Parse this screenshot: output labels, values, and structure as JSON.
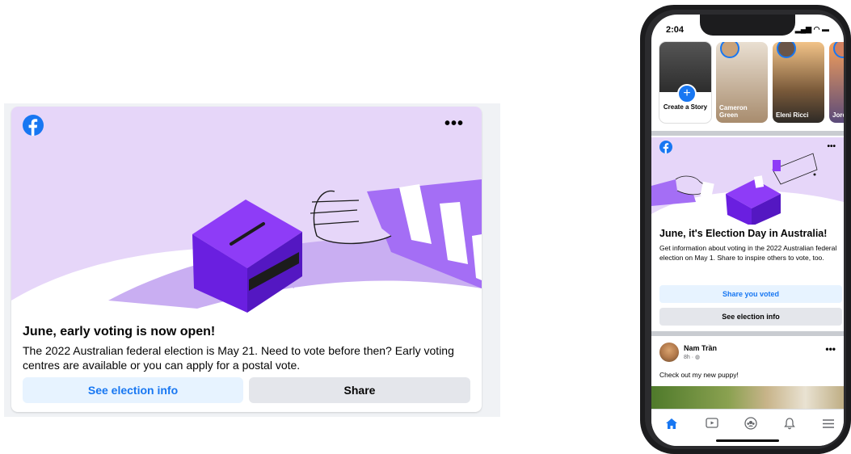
{
  "desktop_card": {
    "title": "June, early voting is now open!",
    "body": "The 2022 Australian federal election is May 21. Need to vote before then? Early voting centres are available or you can apply for a postal vote.",
    "more_label": "•••",
    "primary_button": "See election info",
    "secondary_button": "Share"
  },
  "phone": {
    "status_time": "2:04",
    "stories": {
      "create_label": "Create a Story",
      "items": [
        {
          "name": "Cameron Green"
        },
        {
          "name": "Eleni Ricci"
        },
        {
          "name": "Jorda Jones"
        }
      ]
    },
    "election_card": {
      "more_label": "•••",
      "title": "June, it's Election Day in Australia!",
      "body": "Get information about voting in the 2022 Australian federal election on May 1. Share to inspire others to vote, too.",
      "primary_button": "Share you voted",
      "secondary_button": "See election info"
    },
    "post": {
      "author": "Nam Trần",
      "meta": "8h · ◍",
      "more_label": "•••",
      "text": "Check out my new puppy!"
    },
    "tabs": [
      "home",
      "watch",
      "groups",
      "notifications",
      "menu"
    ]
  },
  "colors": {
    "facebook_blue": "#1877f2",
    "illustration_purple": "#e6d6f9",
    "ballot_box": "#7b2ff7"
  }
}
